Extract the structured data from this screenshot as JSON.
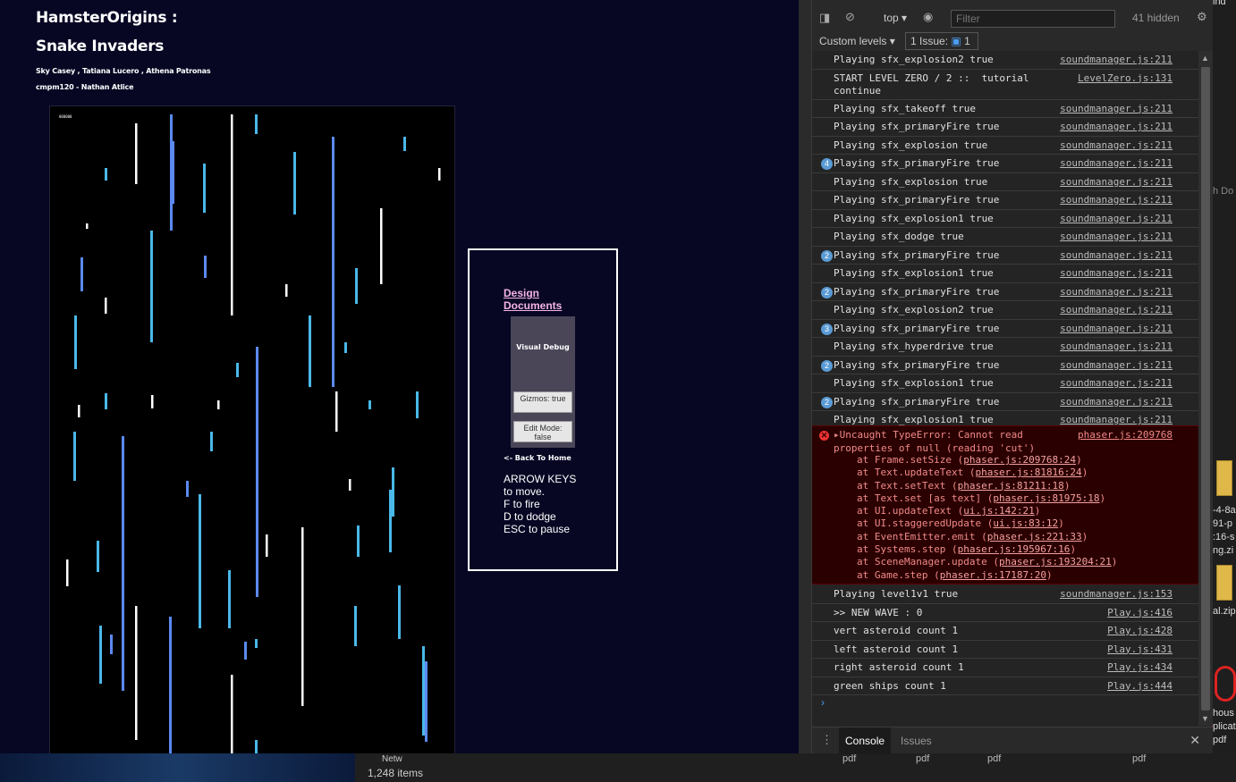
{
  "game": {
    "title_line1": "HamsterOrigins :",
    "title_line2": "Snake Invaders",
    "authors": "Sky Casey , Tatiana Lucero , Athena Patronas",
    "course": "cmpm120 - Nathan Atlice",
    "hud_mini": "000000",
    "star_colors": {
      "white": "#ffffff",
      "blue": "#5b8af0",
      "cyan": "#4ab8e8"
    }
  },
  "side_panel": {
    "design_link": "Design Documents",
    "visual_debug_title": "Visual Debug",
    "gizmos_button": "Gizmos: true",
    "edit_mode_button": "Edit Mode: false",
    "back_home": "<- Back To Home",
    "instructions": [
      "ARROW KEYS",
      "to move.",
      "F to fire",
      "D to dodge",
      "ESC to pause"
    ]
  },
  "devtools": {
    "context": "top",
    "filter_placeholder": "Filter",
    "hidden_count": "41 hidden",
    "custom_levels": "Custom levels",
    "issues_label": "1 Issue:",
    "issues_count": "1",
    "logs": [
      {
        "badge": "",
        "msg": "Playing sfx_explosion2 true",
        "src": "soundmanager.js:211"
      },
      {
        "badge": "",
        "msg": "START LEVEL ZERO / 2 ::  tutorial\ncontinue",
        "src": "LevelZero.js:131"
      },
      {
        "badge": "",
        "msg": "Playing sfx_takeoff true",
        "src": "soundmanager.js:211"
      },
      {
        "badge": "",
        "msg": "Playing sfx_primaryFire true",
        "src": "soundmanager.js:211"
      },
      {
        "badge": "",
        "msg": "Playing sfx_explosion true",
        "src": "soundmanager.js:211"
      },
      {
        "badge": "4",
        "msg": "Playing sfx_primaryFire true",
        "src": "soundmanager.js:211"
      },
      {
        "badge": "",
        "msg": "Playing sfx_explosion true",
        "src": "soundmanager.js:211"
      },
      {
        "badge": "",
        "msg": "Playing sfx_primaryFire true",
        "src": "soundmanager.js:211"
      },
      {
        "badge": "",
        "msg": "Playing sfx_explosion1 true",
        "src": "soundmanager.js:211"
      },
      {
        "badge": "",
        "msg": "Playing sfx_dodge true",
        "src": "soundmanager.js:211"
      },
      {
        "badge": "2",
        "msg": "Playing sfx_primaryFire true",
        "src": "soundmanager.js:211"
      },
      {
        "badge": "",
        "msg": "Playing sfx_explosion1 true",
        "src": "soundmanager.js:211"
      },
      {
        "badge": "2",
        "msg": "Playing sfx_primaryFire true",
        "src": "soundmanager.js:211"
      },
      {
        "badge": "",
        "msg": "Playing sfx_explosion2 true",
        "src": "soundmanager.js:211"
      },
      {
        "badge": "3",
        "msg": "Playing sfx_primaryFire true",
        "src": "soundmanager.js:211"
      },
      {
        "badge": "",
        "msg": "Playing sfx_hyperdrive true",
        "src": "soundmanager.js:211"
      },
      {
        "badge": "2",
        "msg": "Playing sfx_primaryFire true",
        "src": "soundmanager.js:211"
      },
      {
        "badge": "",
        "msg": "Playing sfx_explosion1 true",
        "src": "soundmanager.js:211"
      },
      {
        "badge": "2",
        "msg": "Playing sfx_primaryFire true",
        "src": "soundmanager.js:211"
      },
      {
        "badge": "",
        "msg": "Playing sfx_explosion1 true",
        "src": "soundmanager.js:211"
      }
    ],
    "error": {
      "message": "Uncaught TypeError: Cannot read properties of null (reading 'cut')",
      "src": "phaser.js:209768",
      "stack": [
        {
          "fn": "at Frame.setSize",
          "loc": "phaser.js:209768:24"
        },
        {
          "fn": "at Text.updateText",
          "loc": "phaser.js:81816:24"
        },
        {
          "fn": "at Text.setText",
          "loc": "phaser.js:81211:18"
        },
        {
          "fn": "at Text.set [as text]",
          "loc": "phaser.js:81975:18"
        },
        {
          "fn": "at UI.updateText",
          "loc": "ui.js:142:21"
        },
        {
          "fn": "at UI.staggeredUpdate",
          "loc": "ui.js:83:12"
        },
        {
          "fn": "at EventEmitter.emit",
          "loc": "phaser.js:221:33"
        },
        {
          "fn": "at Systems.step",
          "loc": "phaser.js:195967:16"
        },
        {
          "fn": "at SceneManager.update",
          "loc": "phaser.js:193204:21"
        },
        {
          "fn": "at Game.step",
          "loc": "phaser.js:17187:20"
        }
      ]
    },
    "logs_after": [
      {
        "msg": "Playing level1v1 true",
        "src": "soundmanager.js:153"
      },
      {
        "msg": ">> NEW WAVE : 0",
        "src": "Play.js:416"
      },
      {
        "msg": "vert asteroid count 1",
        "src": "Play.js:428"
      },
      {
        "msg": "left asteroid count 1",
        "src": "Play.js:431"
      },
      {
        "msg": "right asteroid count 1",
        "src": "Play.js:434"
      },
      {
        "msg": "green ships count 1",
        "src": "Play.js:444"
      }
    ],
    "drawer_tabs": [
      "Console",
      "Issues"
    ]
  },
  "background": {
    "items_count": "1,248 items",
    "network_fragment": "Netw",
    "pdf_labels": [
      "pdf",
      "pdf",
      "pdf",
      "pdf"
    ],
    "right_fragments": [
      "ind",
      "h Do",
      "-4-8a",
      "91-p",
      ":16-s",
      "ng.zi",
      "al.zip",
      "hous",
      "plicat",
      "pdf"
    ]
  }
}
